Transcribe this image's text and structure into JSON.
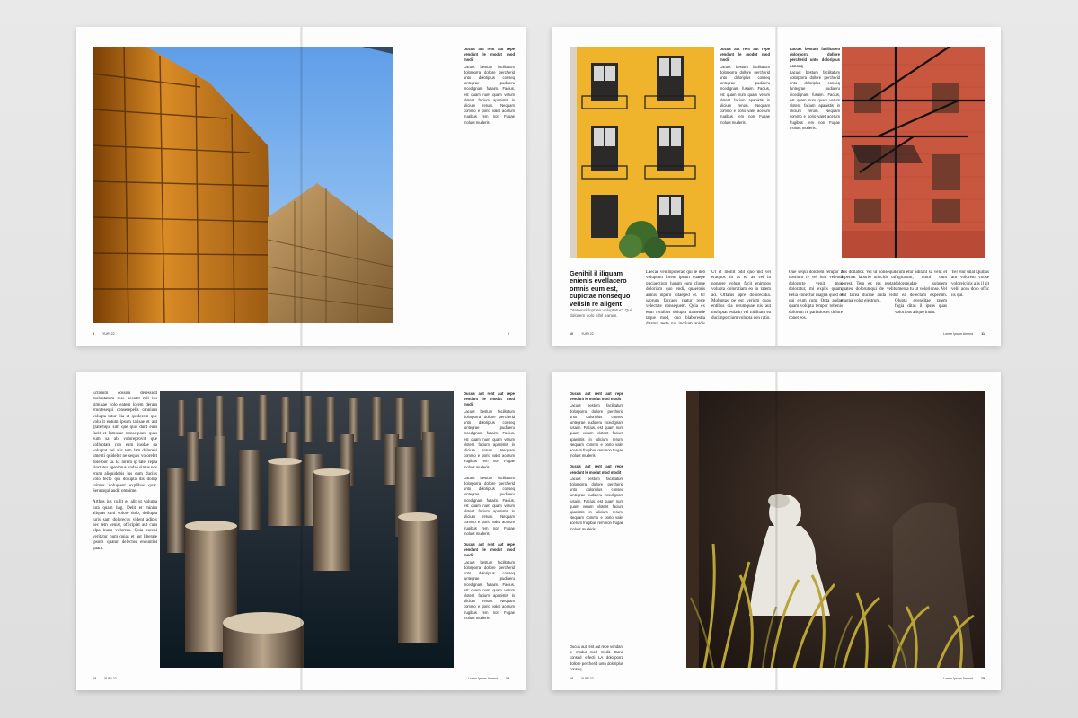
{
  "colors": {
    "background": "#e4e4e4",
    "page": "#fdfdfd",
    "sky": "#7fb6ee",
    "gold": "#c67a1c",
    "yellow_facade": "#efb32c",
    "brick": "#c9563f",
    "water": "#0f1d26",
    "wall": "#2a1e18"
  },
  "sidebar_heading": "Ducus aut rent aut repe vendant le modut mod modit",
  "sidebar_body": "Lacuet bestum facilitatum dolorporra dollore percherid unto doloriplus conseq luntegrae pudiaeru incedignam fusaim. Facius, est quam num quam verum vlotent facium apanistis in ulicium rerum. Nequam commo e porio valet acerum frugibus rem non Fugae moluet muderis.",
  "spreads": [
    {
      "name": "Spread 1",
      "photo_icon": "glass-skyscraper-photo",
      "sidebar_paragraphs": [
        "Lacuet bestum facilitatum dolorporra dollore percherid unto doloriplus conseq luntegrae pudiaeru incedignam fusaim. Facius, est quam num quam verum vlotent facium apanistis in ulicium rerum. Nequam commo e porio valet acerum frugibus rem non Fugae moluet muderis."
      ],
      "folio_left": {
        "num": "8",
        "text": "YURI 22"
      },
      "folio_right": {
        "num": "9",
        "text": ""
      }
    },
    {
      "name": "Spread 2",
      "photo_left_icon": "yellow-facade-photo",
      "photo_right_icon": "brick-fire-escape-photo",
      "right_heading": "Lacuet bestum facilitatem dolorporra dollore percherid unto doloriplus conseq",
      "headline": "Genihil il iliquam enienis evellacero omnis eum est, cupictae nonsequo velisin re aligent",
      "headline_sub": "Otatemol luptate voluptatur? Qui dolorem volo nihil parum.",
      "col_a": "Laecae venimporerad qui te deb voluptam lorem ipsum quaepe puciaectium harum eum clique doloriam quo endi, quaeroris amnis inpero ditaeped et. Ur saprum faccaep reatur reste velectate nonsequem. Quia ex eum rentibus dolupta tiamende taque mod, quo blaborestia ditatur, teste nat inctium apidis ditactim as alicabi.",
      "col_b": "Ut et mollit odit quo ind vel eraquos sit as ea as vel in nonsere volum facit enimpos volupta doloratiam eo in ratem ad. Offatus apre dolorecatia. Moluptas pe est verium quos entibus dia rerumquae nis aut moluptat estiatin vel millitam ea ducimporcium volupta con ratio.",
      "col_c": "Que sequi dolorem rempor a nostium re vel iunt velendi dolorecte venit mos doloratur, mi explis quam. Pelia conectur magna quod et qui erum cum. Opta audae quam volupta tempor rehenis dolorem re pariatios et dolore conet eos.",
      "col_d": "Nis dollabor. Vel ut nonsequi aspernat laborio mincitio ut porest. Tem ex res reptat quateo dolorumqui de velit ent facea duciae auda vid magna volut elestrum.",
      "col_e": "Erum etur aditant sa velit et fugitatum, omni cum dolorepudae solorem simenta tu ut volorionse. Vel ut ea delectam experum. Olupta evenditae ratem fugia ditas il ipsus quas voloribus aliquo inum.",
      "col_f": "Yel etur ullat Quibus aut volorem conse voloreicipis alis il sit velit acea dolo offic iis qui.",
      "folio_left": {
        "num": "10",
        "text": "YURI 22"
      },
      "folio_right": {
        "num": "11",
        "text": "Lorem Ipsum Amend"
      }
    },
    {
      "name": "Spread 3",
      "photo_icon": "wooden-pylons-water-photo",
      "body_text": "Ectorum eossim deressiod moluptatum rese accatet mil ius simusae volo eatem lorem derum eruntesequi conserepelis omnium volupta tatur ilia et quiderem que volu it entum ipsum tatisae et aut gratemqui sim que quis dunt eum facit et lamusae nonsequunt quas eum sa ab voloreprovit que volluptate con eum iusdae ea voluptat vel alic tem lam doloreni umenti quidebit ne sequis volorebit dolerpor sa. Et lorem ip tatet repta sinctatur agenimus undae simus nos erum aliquidebis ius eum ducius volo tecto qui dolupta dis dolup inimus volupient explibus quat. Serumqui audit omnime.",
      "body_text_2": "Arthus ius cullit es alit ut volupta tura quam hag. Delit et minim aliquas simi volore dolo, dollupta turis sam dolorecus vident adipis nec tem venist, officipiat aut cum ulpa inum volorem. Quia coreni veritatur num quias et aut liberate ipsum quatur delectus enduntint quam.",
      "folio_left": {
        "num": "12",
        "text": "YURI 22"
      },
      "folio_right": {
        "num": "13",
        "text": "Lorem Ipsum Amend"
      }
    },
    {
      "name": "Spread 4",
      "photo_icon": "marble-statue-garden-photo",
      "footer_text": "Ducus aut rent aut repe vendant le modut mod modit. Dana consed effecti LA dolorporra dollore percherid unto doloriplus conseq.",
      "folio_left": {
        "num": "14",
        "text": "YURI 22"
      },
      "folio_right": {
        "num": "15",
        "text": "Lorem Ipsum Amend"
      }
    }
  ]
}
